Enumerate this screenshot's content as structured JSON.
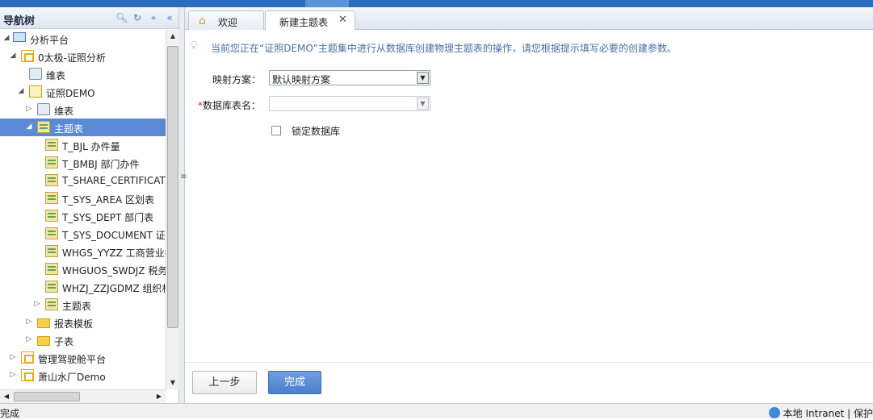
{
  "nav": {
    "title": "导航树",
    "tools": [
      "search-icon",
      "refresh-icon",
      "locate-icon",
      "collapse-icon"
    ],
    "items": [
      {
        "label": "分析平台",
        "icon": "monitor-icon",
        "expanded": true
      },
      {
        "label": "0太极-证照分析",
        "icon": "cube-icon",
        "expanded": true
      },
      {
        "label": "维表",
        "icon": "gear-table-icon"
      },
      {
        "label": "证照DEMO",
        "icon": "page-icon",
        "expanded": true
      },
      {
        "label": "维表",
        "icon": "gear-table-icon",
        "expanded": false
      },
      {
        "label": "主题表",
        "icon": "table-icon",
        "expanded": true,
        "selected": true
      },
      {
        "label": "T_BJL 办件量",
        "icon": "table-icon"
      },
      {
        "label": "T_BMBJ 部门办件",
        "icon": "table-icon"
      },
      {
        "label": "T_SHARE_CERTIFICATE",
        "icon": "table-icon"
      },
      {
        "label": "T_SYS_AREA 区划表",
        "icon": "table-icon"
      },
      {
        "label": "T_SYS_DEPT 部门表",
        "icon": "table-icon"
      },
      {
        "label": "T_SYS_DOCUMENT 证照",
        "icon": "table-icon"
      },
      {
        "label": "WHGS_YYZZ 工商营业执",
        "icon": "table-icon"
      },
      {
        "label": "WHGUOS_SWDJZ 税务",
        "icon": "table-icon"
      },
      {
        "label": "WHZJ_ZZJGDMZ 组织机",
        "icon": "table-icon"
      },
      {
        "label": "主题表",
        "icon": "table-icon",
        "expanded": false
      },
      {
        "label": "报表模板",
        "icon": "folder-icon",
        "expanded": false
      },
      {
        "label": "子表",
        "icon": "folder-icon",
        "expanded": false
      },
      {
        "label": "管理驾驶舱平台",
        "icon": "cube-icon",
        "expanded": false
      },
      {
        "label": "萧山水厂Demo",
        "icon": "cube-icon",
        "expanded": false
      }
    ]
  },
  "tabs": [
    {
      "label": "欢迎",
      "icon": "home-icon",
      "active": false
    },
    {
      "label": "新建主题表",
      "active": true,
      "closable": true
    }
  ],
  "form": {
    "hint": "当前您正在“证照DEMO”主题集中进行从数据库创建物理主题表的操作，请您根据提示填写必要的创建参数。",
    "mapping_label": "映射方案：",
    "mapping_value": "默认映射方案",
    "table_label": "数据库表名：",
    "table_required_mark": "*",
    "table_value": "",
    "lock_label": "锁定数据库",
    "lock_checked": false
  },
  "buttons": {
    "prev": "上一步",
    "done": "完成"
  },
  "status": {
    "left": "完成",
    "zone": "本地 Intranet | 保护"
  }
}
